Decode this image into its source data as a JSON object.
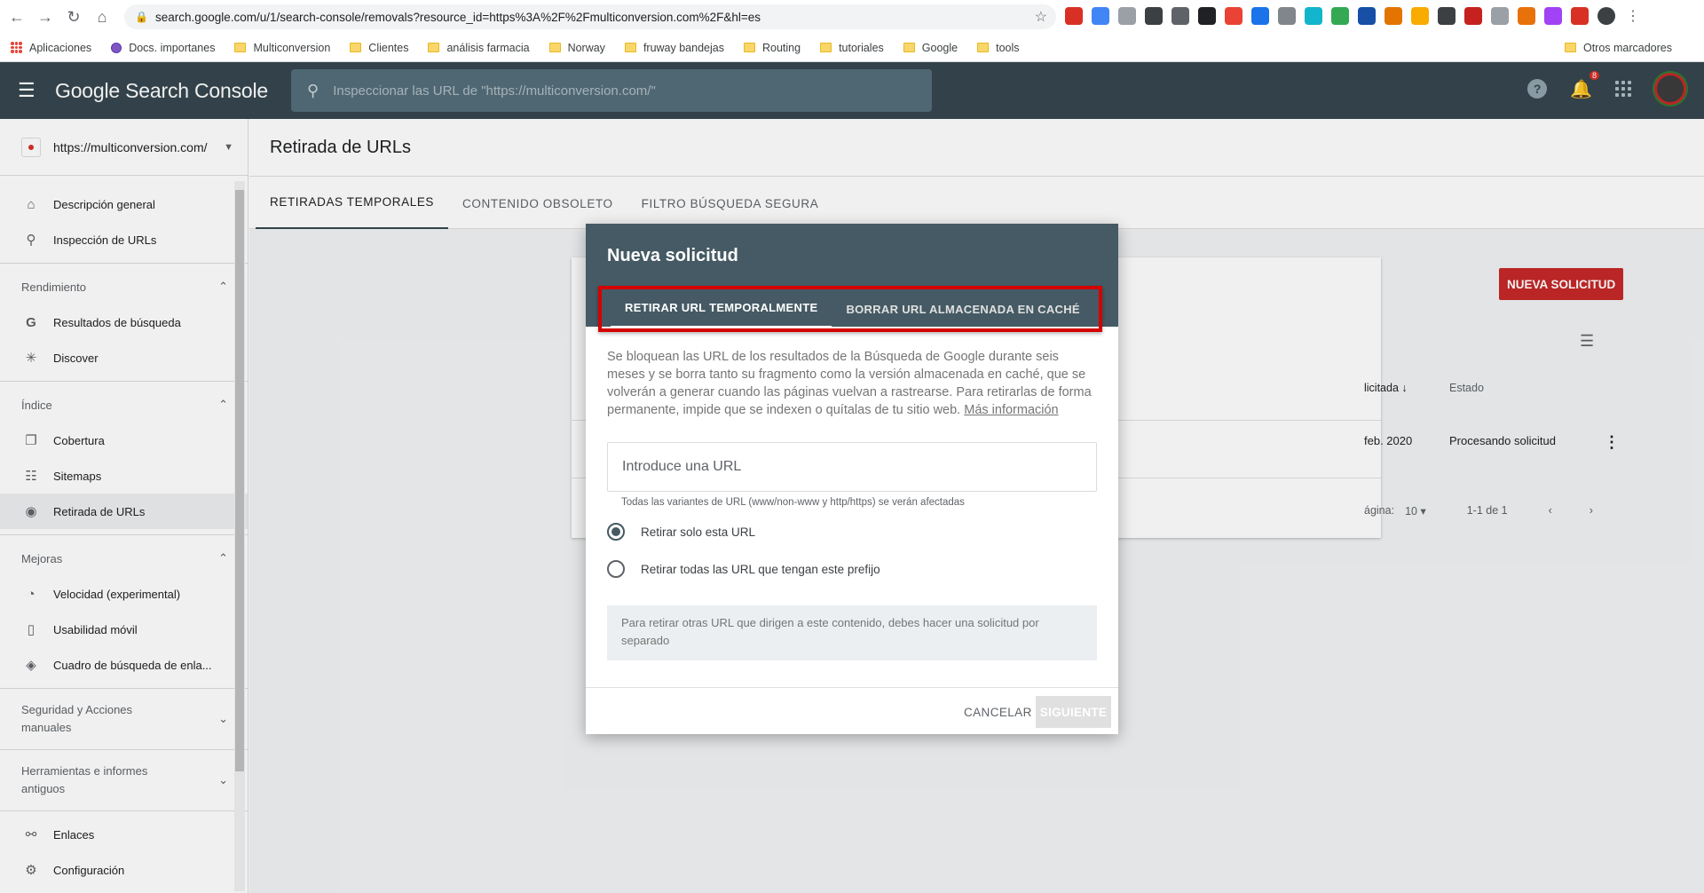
{
  "browser": {
    "url": "search.google.com/u/1/search-console/removals?resource_id=https%3A%2F%2Fmulticonversion.com%2F&hl=es",
    "bookmarks": [
      "Aplicaciones",
      "Docs. importanes",
      "Multiconversion",
      "Clientes",
      "análisis farmacia",
      "Norway",
      "fruway bandejas",
      "Routing",
      "tutoriales",
      "Google",
      "tools"
    ],
    "other_bookmarks": "Otros marcadores"
  },
  "header": {
    "product_name": "Google Search Console",
    "search_placeholder": "Inspeccionar las URL de \"https://multiconversion.com/\"",
    "notification_count": "8"
  },
  "sidebar": {
    "property": "https://multiconversion.com/",
    "items": [
      {
        "label": "Descripción general",
        "icon": "home-icon"
      },
      {
        "label": "Inspección de URLs",
        "icon": "search-icon"
      }
    ],
    "sections": [
      {
        "title": "Rendimiento",
        "items": [
          {
            "label": "Resultados de búsqueda",
            "icon": "google-g-icon"
          },
          {
            "label": "Discover",
            "icon": "asterisk-icon"
          }
        ]
      },
      {
        "title": "Índice",
        "items": [
          {
            "label": "Cobertura",
            "icon": "copy-icon"
          },
          {
            "label": "Sitemaps",
            "icon": "sitemap-icon"
          },
          {
            "label": "Retirada de URLs",
            "icon": "eye-off-icon"
          }
        ]
      },
      {
        "title": "Mejoras",
        "items": [
          {
            "label": "Velocidad (experimental)",
            "icon": "speed-icon"
          },
          {
            "label": "Usabilidad móvil",
            "icon": "phone-icon"
          },
          {
            "label": "Cuadro de búsqueda de enla...",
            "icon": "layers-icon"
          }
        ]
      }
    ],
    "collapsed_sections": [
      "Seguridad y Acciones manuales",
      "Herramientas e informes antiguos"
    ],
    "bottom_items": [
      {
        "label": "Enlaces",
        "icon": "links-icon"
      },
      {
        "label": "Configuración",
        "icon": "gear-icon"
      }
    ]
  },
  "page": {
    "title": "Retirada de URLs",
    "tabs": [
      "RETIRADAS TEMPORALES",
      "CONTENIDO OBSOLETO",
      "FILTRO BÚSQUEDA SEGURA"
    ],
    "new_request_button": "NUEVA SOLICITUD",
    "table": {
      "columns": [
        "licitada",
        "Estado"
      ],
      "row": {
        "date": "feb. 2020",
        "status": "Procesando solicitud"
      },
      "pager": {
        "label": "ágina:",
        "per_page": "10",
        "range": "1-1 de 1"
      }
    }
  },
  "dialog": {
    "title": "Nueva solicitud",
    "tabs": [
      "RETIRAR URL TEMPORALMENTE",
      "BORRAR URL ALMACENADA EN CACHÉ"
    ],
    "description": "Se bloquean las URL de los resultados de la Búsqueda de Google durante seis meses y se borra tanto su fragmento como la versión almacenada en caché, que se volverán a generar cuando las páginas vuelvan a rastrearse. Para retirarlas de forma permanente, impide que se indexen o quítalas de tu sitio web.",
    "more_info_link": "Más información",
    "url_placeholder": "Introduce una URL",
    "url_hint": "Todas las variantes de URL (www/non-www y http/https) se verán afectadas",
    "options": [
      "Retirar solo esta URL",
      "Retirar todas las URL que tengan este prefijo"
    ],
    "selected_option": "Retirar solo esta URL",
    "note": "Para retirar otras URL que dirigen a este contenido, debes hacer una solicitud por separado",
    "cancel": "CANCELAR",
    "next": "SIGUIENTE"
  },
  "colors": {
    "header": "#37474f",
    "dialog_header": "#455a64",
    "accent_red": "#c62828",
    "highlight_box": "#d50000"
  }
}
